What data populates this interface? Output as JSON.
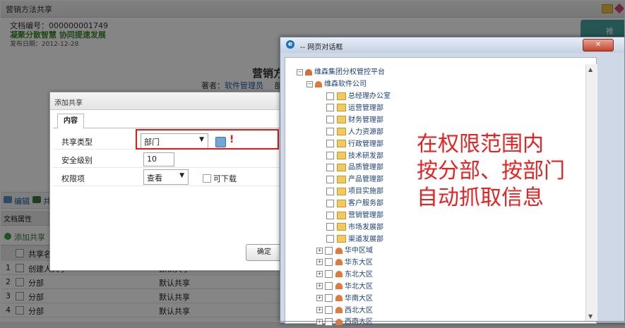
{
  "window_title": "营销方法共享",
  "doc": {
    "number_text": "文档编号：000000001749",
    "slogan": "凝聚分散智慧  协同提速发展",
    "date_text": "发布日期：2012-12-28",
    "title": "营销方",
    "author_label": "著者：",
    "author_value": "软件管理员",
    "dept_label": "部"
  },
  "side_tab": {
    "line1": "推",
    "line2": "送"
  },
  "toolbar": {
    "edit_label": "编辑",
    "share_label": "共"
  },
  "doc_attr_label": "文档属性",
  "add_share_label": "添加共享",
  "table": {
    "col_name": "共享名称",
    "col_type": "共享方式",
    "rows": [
      {
        "idx": "1",
        "name": "创建人共享",
        "type": "默认共享"
      },
      {
        "idx": "2",
        "name": "分部",
        "type": "默认共享"
      },
      {
        "idx": "3",
        "name": "分部",
        "type": "默认共享"
      },
      {
        "idx": "4",
        "name": "分部",
        "type": "默认共享"
      }
    ]
  },
  "add_share_dialog": {
    "title": "添加共享",
    "tab": "内容",
    "share_type_label": "共享类型",
    "share_type_value": "部门",
    "security_label": "安全级别",
    "security_value": "10",
    "permission_label": "权限项",
    "permission_value": "查看",
    "download_label": "可下载",
    "ok_label": "确定"
  },
  "web_dialog": {
    "title": "-- 网页对话框",
    "close_label": "✕",
    "tree": {
      "root": "维森集团分权管控平台",
      "company": "维森软件公司",
      "departments": [
        "总经理办公室",
        "运营管理部",
        "财务管理部",
        "人力资源部",
        "行政管理部",
        "技术研发部",
        "品质管理部",
        "产品管理部",
        "项目实施部",
        "客户服务部",
        "营销管理部",
        "市场发展部",
        "渠道发展部"
      ],
      "regions": [
        "华中区域",
        "华东大区",
        "东北大区",
        "华北大区",
        "华南大区",
        "西北大区",
        "西南大区"
      ]
    }
  },
  "annotation": [
    "在权限范围内",
    "按分部、按部门",
    "自动抓取信息"
  ],
  "colors": {
    "annotation": "#e62222",
    "highlight_box": "#e21a1a",
    "link": "#1b5a9c"
  }
}
